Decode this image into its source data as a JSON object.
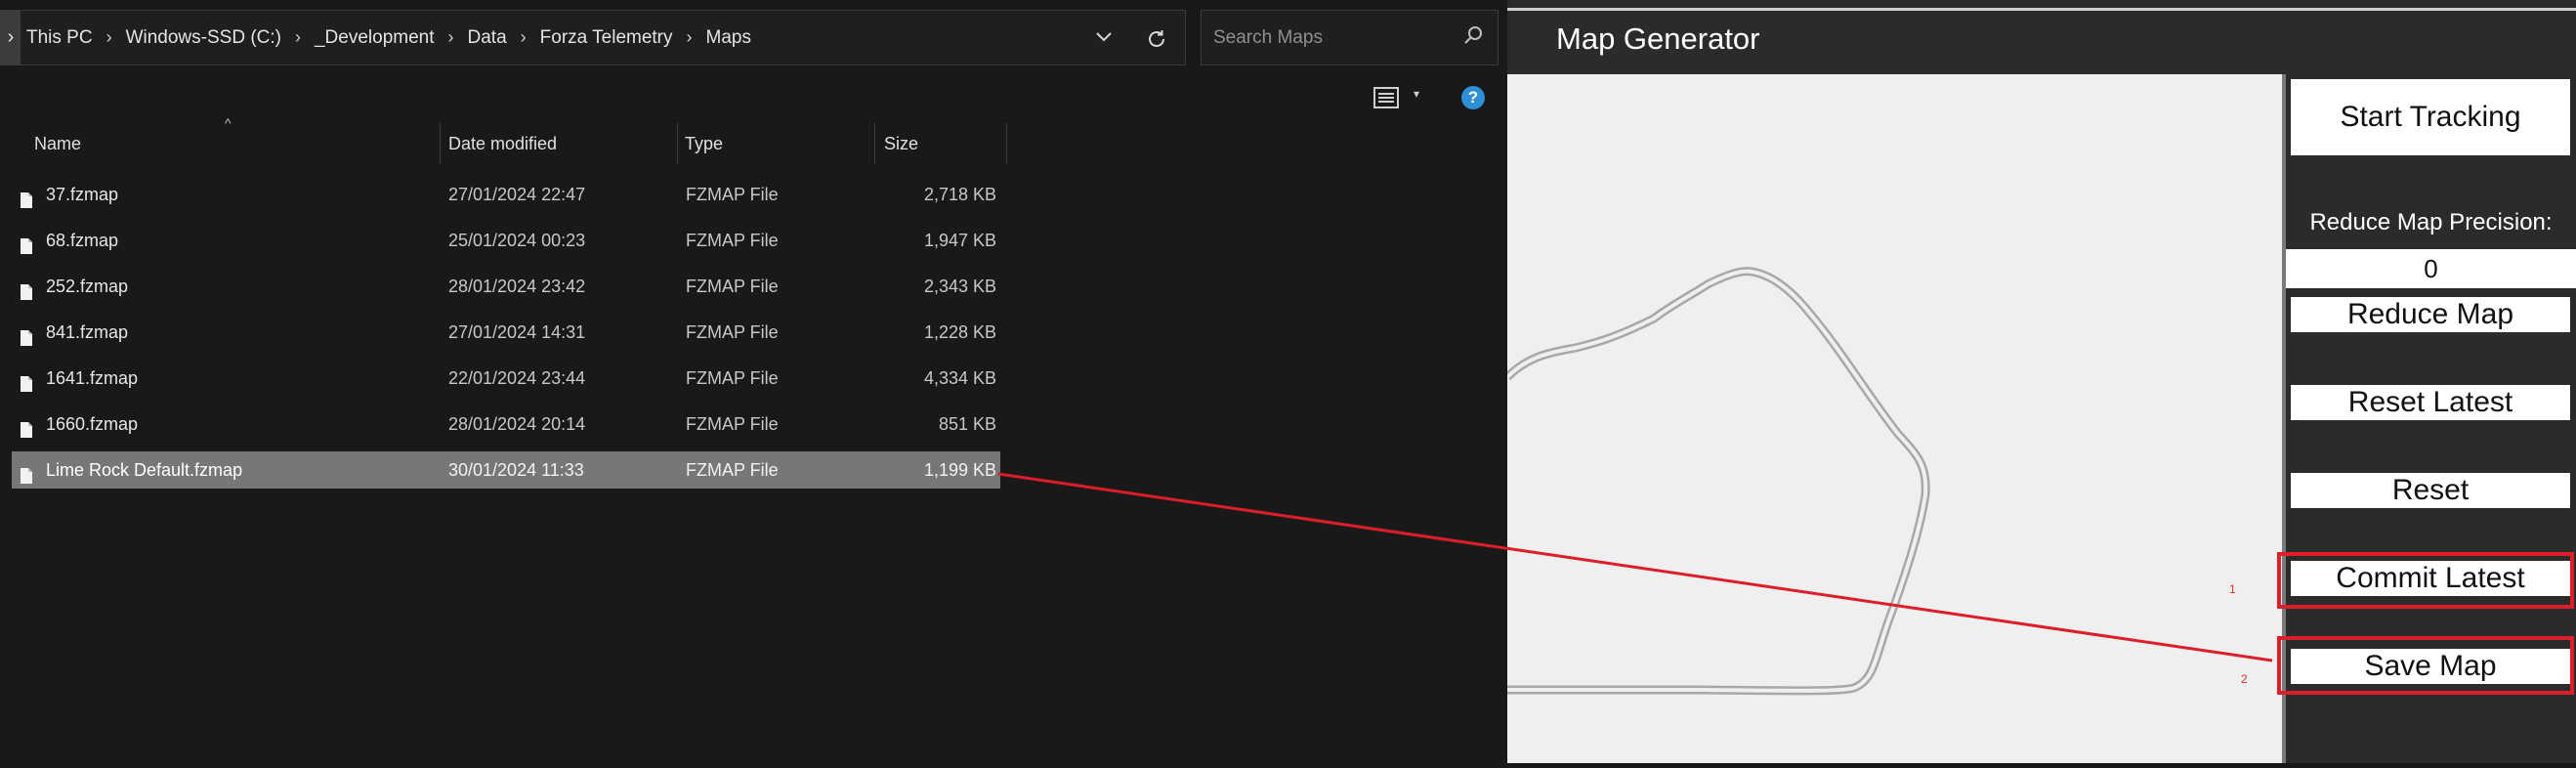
{
  "explorer": {
    "breadcrumb": [
      "This PC",
      "Windows-SSD (C:)",
      "_Development",
      "Data",
      "Forza Telemetry",
      "Maps"
    ],
    "search_placeholder": "Search Maps",
    "columns": {
      "name": "Name",
      "date": "Date modified",
      "type": "Type",
      "size": "Size"
    },
    "files": [
      {
        "name": "37.fzmap",
        "date": "27/01/2024 22:47",
        "type": "FZMAP File",
        "size": "2,718 KB"
      },
      {
        "name": "68.fzmap",
        "date": "25/01/2024 00:23",
        "type": "FZMAP File",
        "size": "1,947 KB"
      },
      {
        "name": "252.fzmap",
        "date": "28/01/2024 23:42",
        "type": "FZMAP File",
        "size": "2,343 KB"
      },
      {
        "name": "841.fzmap",
        "date": "27/01/2024 14:31",
        "type": "FZMAP File",
        "size": "1,228 KB"
      },
      {
        "name": "1641.fzmap",
        "date": "22/01/2024 23:44",
        "type": "FZMAP File",
        "size": "4,334 KB"
      },
      {
        "name": "1660.fzmap",
        "date": "28/01/2024 20:14",
        "type": "FZMAP File",
        "size": "851 KB"
      },
      {
        "name": "Lime Rock Default.fzmap",
        "date": "30/01/2024 11:33",
        "type": "FZMAP File",
        "size": "1,199 KB",
        "selected": true
      }
    ]
  },
  "map_generator": {
    "title": "Map Generator",
    "start_tracking": "Start Tracking",
    "precision_label": "Reduce Map Precision:",
    "precision_value": "0",
    "reduce_map": "Reduce Map",
    "reset_latest": "Reset Latest",
    "reset": "Reset",
    "commit_latest": "Commit Latest",
    "save_map": "Save Map"
  },
  "annotations": {
    "step1": "1",
    "step2": "2",
    "color": "#dc1d2a"
  }
}
